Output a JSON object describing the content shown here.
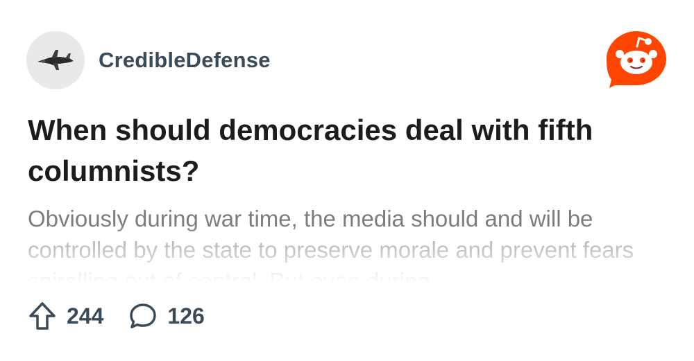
{
  "post": {
    "subreddit": "CredibleDefense",
    "title": "When should democracies deal with fifth columnists?",
    "body": "Obviously during war time, the media should and will be controlled by the state to preserve morale and prevent fears spiralling out of control. But even during",
    "upvotes": "244",
    "comments": "126"
  },
  "icons": {
    "avatar": "fighter-jet-icon",
    "brand": "reddit-logo-icon",
    "upvote": "upvote-arrow-icon",
    "comment": "comment-bubble-icon"
  },
  "colors": {
    "brand": "#ff4500",
    "subreddit_text": "#3a4a57",
    "title_text": "#1c1c1c",
    "body_text": "#7c7c7c",
    "avatar_bg": "#e9e9ea"
  }
}
